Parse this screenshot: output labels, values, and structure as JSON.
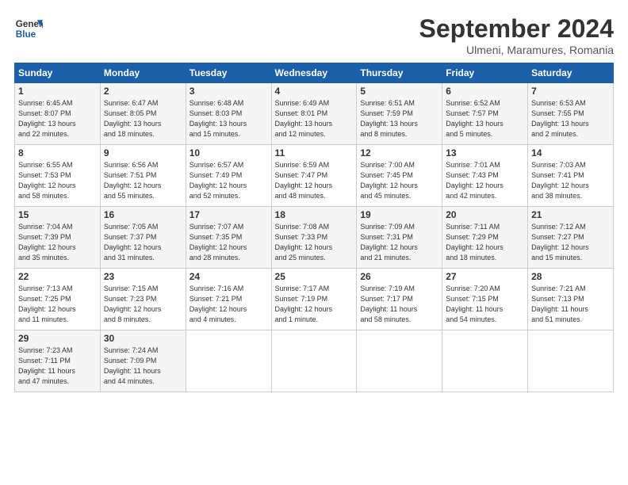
{
  "header": {
    "logo_general": "General",
    "logo_blue": "Blue",
    "month": "September 2024",
    "location": "Ulmeni, Maramures, Romania"
  },
  "weekdays": [
    "Sunday",
    "Monday",
    "Tuesday",
    "Wednesday",
    "Thursday",
    "Friday",
    "Saturday"
  ],
  "weeks": [
    [
      {
        "day": "1",
        "info": "Sunrise: 6:45 AM\nSunset: 8:07 PM\nDaylight: 13 hours\nand 22 minutes."
      },
      {
        "day": "2",
        "info": "Sunrise: 6:47 AM\nSunset: 8:05 PM\nDaylight: 13 hours\nand 18 minutes."
      },
      {
        "day": "3",
        "info": "Sunrise: 6:48 AM\nSunset: 8:03 PM\nDaylight: 13 hours\nand 15 minutes."
      },
      {
        "day": "4",
        "info": "Sunrise: 6:49 AM\nSunset: 8:01 PM\nDaylight: 13 hours\nand 12 minutes."
      },
      {
        "day": "5",
        "info": "Sunrise: 6:51 AM\nSunset: 7:59 PM\nDaylight: 13 hours\nand 8 minutes."
      },
      {
        "day": "6",
        "info": "Sunrise: 6:52 AM\nSunset: 7:57 PM\nDaylight: 13 hours\nand 5 minutes."
      },
      {
        "day": "7",
        "info": "Sunrise: 6:53 AM\nSunset: 7:55 PM\nDaylight: 13 hours\nand 2 minutes."
      }
    ],
    [
      {
        "day": "8",
        "info": "Sunrise: 6:55 AM\nSunset: 7:53 PM\nDaylight: 12 hours\nand 58 minutes."
      },
      {
        "day": "9",
        "info": "Sunrise: 6:56 AM\nSunset: 7:51 PM\nDaylight: 12 hours\nand 55 minutes."
      },
      {
        "day": "10",
        "info": "Sunrise: 6:57 AM\nSunset: 7:49 PM\nDaylight: 12 hours\nand 52 minutes."
      },
      {
        "day": "11",
        "info": "Sunrise: 6:59 AM\nSunset: 7:47 PM\nDaylight: 12 hours\nand 48 minutes."
      },
      {
        "day": "12",
        "info": "Sunrise: 7:00 AM\nSunset: 7:45 PM\nDaylight: 12 hours\nand 45 minutes."
      },
      {
        "day": "13",
        "info": "Sunrise: 7:01 AM\nSunset: 7:43 PM\nDaylight: 12 hours\nand 42 minutes."
      },
      {
        "day": "14",
        "info": "Sunrise: 7:03 AM\nSunset: 7:41 PM\nDaylight: 12 hours\nand 38 minutes."
      }
    ],
    [
      {
        "day": "15",
        "info": "Sunrise: 7:04 AM\nSunset: 7:39 PM\nDaylight: 12 hours\nand 35 minutes."
      },
      {
        "day": "16",
        "info": "Sunrise: 7:05 AM\nSunset: 7:37 PM\nDaylight: 12 hours\nand 31 minutes."
      },
      {
        "day": "17",
        "info": "Sunrise: 7:07 AM\nSunset: 7:35 PM\nDaylight: 12 hours\nand 28 minutes."
      },
      {
        "day": "18",
        "info": "Sunrise: 7:08 AM\nSunset: 7:33 PM\nDaylight: 12 hours\nand 25 minutes."
      },
      {
        "day": "19",
        "info": "Sunrise: 7:09 AM\nSunset: 7:31 PM\nDaylight: 12 hours\nand 21 minutes."
      },
      {
        "day": "20",
        "info": "Sunrise: 7:11 AM\nSunset: 7:29 PM\nDaylight: 12 hours\nand 18 minutes."
      },
      {
        "day": "21",
        "info": "Sunrise: 7:12 AM\nSunset: 7:27 PM\nDaylight: 12 hours\nand 15 minutes."
      }
    ],
    [
      {
        "day": "22",
        "info": "Sunrise: 7:13 AM\nSunset: 7:25 PM\nDaylight: 12 hours\nand 11 minutes."
      },
      {
        "day": "23",
        "info": "Sunrise: 7:15 AM\nSunset: 7:23 PM\nDaylight: 12 hours\nand 8 minutes."
      },
      {
        "day": "24",
        "info": "Sunrise: 7:16 AM\nSunset: 7:21 PM\nDaylight: 12 hours\nand 4 minutes."
      },
      {
        "day": "25",
        "info": "Sunrise: 7:17 AM\nSunset: 7:19 PM\nDaylight: 12 hours\nand 1 minute."
      },
      {
        "day": "26",
        "info": "Sunrise: 7:19 AM\nSunset: 7:17 PM\nDaylight: 11 hours\nand 58 minutes."
      },
      {
        "day": "27",
        "info": "Sunrise: 7:20 AM\nSunset: 7:15 PM\nDaylight: 11 hours\nand 54 minutes."
      },
      {
        "day": "28",
        "info": "Sunrise: 7:21 AM\nSunset: 7:13 PM\nDaylight: 11 hours\nand 51 minutes."
      }
    ],
    [
      {
        "day": "29",
        "info": "Sunrise: 7:23 AM\nSunset: 7:11 PM\nDaylight: 11 hours\nand 47 minutes."
      },
      {
        "day": "30",
        "info": "Sunrise: 7:24 AM\nSunset: 7:09 PM\nDaylight: 11 hours\nand 44 minutes."
      },
      {
        "day": "",
        "info": ""
      },
      {
        "day": "",
        "info": ""
      },
      {
        "day": "",
        "info": ""
      },
      {
        "day": "",
        "info": ""
      },
      {
        "day": "",
        "info": ""
      }
    ]
  ]
}
